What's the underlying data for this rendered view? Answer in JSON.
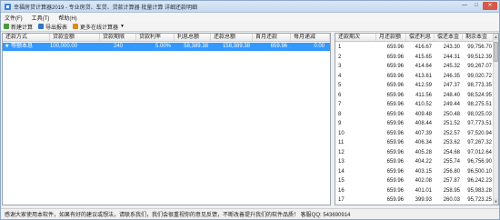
{
  "window": {
    "title": "幸福房贷计算器2019 - 专业房贷、车贷、贷款计算器 批量计算 详细还款明细",
    "controls": [
      "—",
      "□",
      "✕"
    ]
  },
  "menu": {
    "items": [
      "文件(F)",
      "工具(T)",
      "帮助(H)"
    ]
  },
  "toolbar": {
    "new_label": "新建计算",
    "export_label": "导出报表",
    "more_label": "更多在线计算器"
  },
  "loan_table": {
    "headers": [
      "还款方式",
      "贷款金额",
      "贷款期限",
      "贷款利率",
      "利息总额",
      "还款总额",
      "首月还款",
      "每月递减"
    ],
    "rows": [
      [
        "等额本息",
        "100,000.00",
        "240",
        "5.00%",
        "58,389.38",
        "158,389.38",
        "659.96",
        "0.00"
      ]
    ]
  },
  "schedule_table": {
    "headers": [
      "还款期次",
      "月还款额",
      "偿还利息",
      "偿还本金",
      "剩余本金"
    ],
    "rows": [
      [
        "1",
        "659.96",
        "416.67",
        "243.30",
        "99,756.70"
      ],
      [
        "2",
        "659.96",
        "415.65",
        "244.31",
        "99,512.39"
      ],
      [
        "3",
        "659.96",
        "414.64",
        "245.32",
        "99,267.07"
      ],
      [
        "4",
        "659.96",
        "413.61",
        "246.35",
        "99,020.72"
      ],
      [
        "5",
        "659.96",
        "412.59",
        "247.37",
        "98,773.35"
      ],
      [
        "6",
        "659.96",
        "411.56",
        "248.40",
        "98,524.95"
      ],
      [
        "7",
        "659.96",
        "410.52",
        "249.44",
        "98,275.51"
      ],
      [
        "8",
        "659.96",
        "409.48",
        "250.48",
        "98,025.03"
      ],
      [
        "9",
        "659.96",
        "408.44",
        "251.52",
        "97,773.51"
      ],
      [
        "10",
        "659.96",
        "407.39",
        "252.57",
        "97,520.94"
      ],
      [
        "11",
        "659.96",
        "406.34",
        "253.62",
        "97,267.32"
      ],
      [
        "12",
        "659.96",
        "405.28",
        "254.68",
        "97,012.64"
      ],
      [
        "13",
        "659.96",
        "404.22",
        "255.74",
        "96,756.90"
      ],
      [
        "14",
        "659.96",
        "403.15",
        "256.80",
        "96,500.10"
      ],
      [
        "15",
        "659.96",
        "402.08",
        "257.87",
        "96,242.23"
      ],
      [
        "16",
        "659.96",
        "401.01",
        "258.95",
        "95,983.28"
      ],
      [
        "17",
        "659.96",
        "399.93",
        "260.03",
        "95,723.25"
      ]
    ]
  },
  "status": {
    "text": "感谢大家使用本软件，如果有好的建议或想法，请联系我们，我们会很重视你的意见反馈，不断改善提升我们的软件品质！ 客服QQ: 543690914"
  },
  "colors": {
    "selection": "#3399ff",
    "title_bar": "#c6d9ef"
  }
}
